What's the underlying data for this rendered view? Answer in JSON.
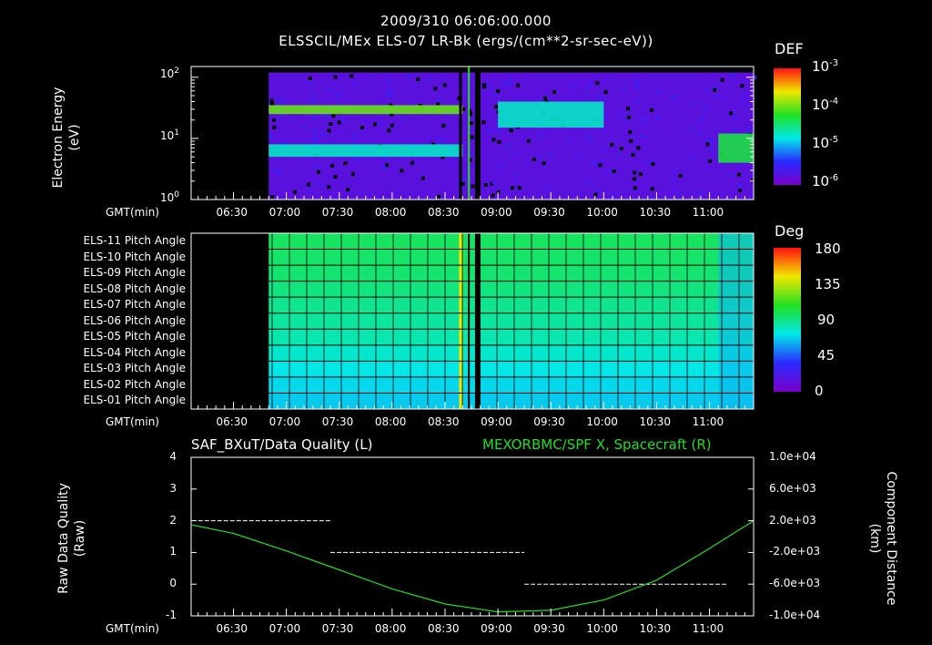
{
  "header": {
    "timestamp": "2009/310 06:06:00.000",
    "subtitle": "ELSSCIL/MEx ELS-07 LR-Bk  (ergs/(cm**2-sr-sec-eV))"
  },
  "time_axis": {
    "label": "GMT(min)",
    "ticks": [
      "06:30",
      "07:00",
      "07:30",
      "08:00",
      "08:30",
      "09:00",
      "09:30",
      "10:00",
      "10:30",
      "11:00"
    ]
  },
  "panel1": {
    "ylabel_line1": "Electron Energy",
    "ylabel_line2": "(eV)",
    "ytick_base": "10",
    "ytick_exponents": [
      "2",
      "1",
      "0"
    ],
    "colorbar_title": "DEF",
    "colorbar_base": "10",
    "colorbar_exponents": [
      "-3",
      "-4",
      "-5",
      "-6"
    ]
  },
  "panel2": {
    "row_labels": [
      "ELS-11 Pitch Angle",
      "ELS-10 Pitch Angle",
      "ELS-09 Pitch Angle",
      "ELS-08 Pitch Angle",
      "ELS-07 Pitch Angle",
      "ELS-06 Pitch Angle",
      "ELS-05 Pitch Angle",
      "ELS-04 Pitch Angle",
      "ELS-03 Pitch Angle",
      "ELS-02 Pitch Angle",
      "ELS-01 Pitch Angle"
    ],
    "colorbar_title": "Deg",
    "colorbar_ticks": [
      "180",
      "135",
      "90",
      "45",
      "0"
    ]
  },
  "panel3": {
    "title_left": "SAF_BXuT/Data Quality (L)",
    "title_right": "MEXORBMC/SPF X, Spacecraft (R)",
    "ylabel_left_line1": "Raw Data Quality",
    "ylabel_left_line2": "(Raw)",
    "ylabel_right_line1": "Component Distance",
    "ylabel_right_line2": "(km)",
    "left_ticks": [
      "4",
      "3",
      "2",
      "1",
      "0",
      "-1"
    ],
    "right_ticks": [
      "1.0e+04",
      "6.0e+03",
      "2.0e+03",
      "-2.0e+03",
      "-6.0e+03",
      "-1.0e+04"
    ],
    "colors": {
      "quality": "#ffffff",
      "distance": "#22dd22"
    }
  },
  "chart_data": [
    {
      "type": "heatmap",
      "title": "ELSSCIL/MEx ELS-07 LR-Bk  (ergs/(cm**2-sr-sec-eV))",
      "xlabel": "GMT(min)",
      "ylabel": "Electron Energy (eV)",
      "x_range": [
        "06:06",
        "11:25"
      ],
      "y_scale": "log",
      "ylim": [
        1,
        150
      ],
      "colorbar": {
        "label": "DEF",
        "scale": "log",
        "range": [
          1e-06,
          0.001
        ]
      },
      "data_start": "06:50",
      "bands": [
        {
          "time_from": "06:50",
          "time_to": "08:40",
          "energy_eV": [
            25,
            35
          ],
          "level": 0.0001
        },
        {
          "time_from": "06:50",
          "time_to": "08:40",
          "energy_eV": [
            5,
            8
          ],
          "level": 2e-05
        },
        {
          "time_from": "09:00",
          "time_to": "10:00",
          "energy_eV": [
            15,
            40
          ],
          "level": 2e-05
        },
        {
          "time_from": "11:05",
          "time_to": "11:25",
          "energy_eV": [
            4,
            12
          ],
          "level": 5e-05
        }
      ]
    },
    {
      "type": "heatmap",
      "xlabel": "GMT(min)",
      "rows": [
        "ELS-11",
        "ELS-10",
        "ELS-09",
        "ELS-08",
        "ELS-07",
        "ELS-06",
        "ELS-05",
        "ELS-04",
        "ELS-03",
        "ELS-02",
        "ELS-01"
      ],
      "colorbar": {
        "label": "Deg",
        "range": [
          0,
          180
        ]
      },
      "pitch_angle_deg": [
        110,
        108,
        105,
        100,
        95,
        90,
        85,
        75,
        65,
        60,
        55
      ],
      "data_start": "06:50"
    },
    {
      "type": "line",
      "xlabel": "GMT(min)",
      "series": [
        {
          "name": "SAF_BXuT/Data Quality (L)",
          "axis": "left",
          "ylim": [
            -1,
            4
          ],
          "segments": [
            {
              "from": "06:10",
              "to": "07:25",
              "value": 2
            },
            {
              "from": "07:25",
              "to": "09:15",
              "value": 1
            },
            {
              "from": "09:15",
              "to": "11:10",
              "value": 0
            }
          ]
        },
        {
          "name": "MEXORBMC/SPF X, Spacecraft (R)",
          "axis": "right",
          "ylim": [
            -10000,
            10000
          ],
          "x": [
            "06:06",
            "06:30",
            "07:00",
            "07:30",
            "08:00",
            "08:30",
            "09:00",
            "09:30",
            "10:00",
            "10:30",
            "11:00",
            "11:25"
          ],
          "values": [
            1500,
            400,
            -1800,
            -4200,
            -6600,
            -8500,
            -9500,
            -9300,
            -8000,
            -5500,
            -1500,
            2000
          ]
        }
      ]
    }
  ]
}
